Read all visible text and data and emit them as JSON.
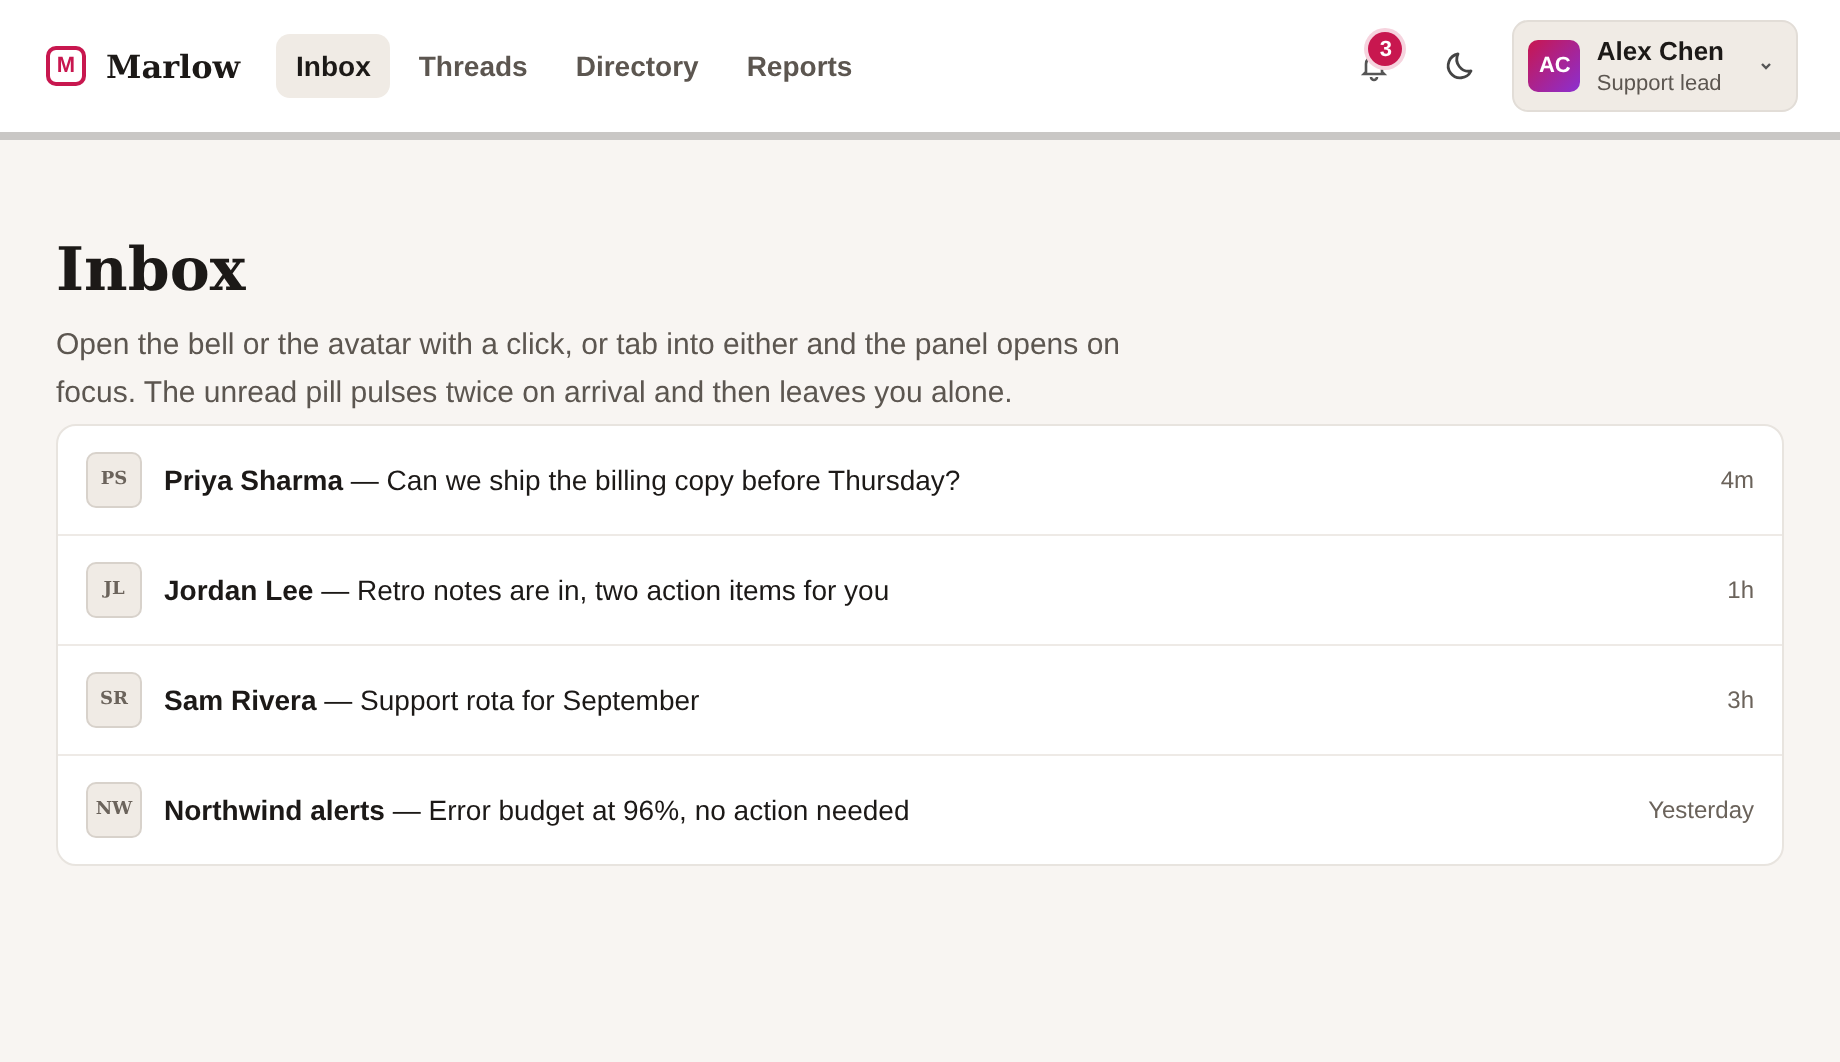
{
  "brand": {
    "name": "Marlow",
    "logo_letter": "M"
  },
  "nav": [
    {
      "label": "Inbox",
      "selected": true
    },
    {
      "label": "Threads",
      "selected": false
    },
    {
      "label": "Directory",
      "selected": false
    },
    {
      "label": "Reports",
      "selected": false
    }
  ],
  "notifications": {
    "count": "3"
  },
  "user": {
    "initials": "AC",
    "name": "Alex Chen",
    "role": "Support lead"
  },
  "page": {
    "title": "Inbox",
    "description": "Open the bell or the avatar with a click, or tab into either and the panel opens on focus. The unread pill pulses twice on arrival and then leaves you alone."
  },
  "messages": [
    {
      "initials": "PS",
      "text": "**Priya Sharma** — Can we ship the billing copy before Thursday?",
      "time": "4m"
    },
    {
      "initials": "JL",
      "text": "**Jordan Lee** — Retro notes are in, two action items for you",
      "time": "1h"
    },
    {
      "initials": "SR",
      "text": "**Sam Rivera** — Support rota for September",
      "time": "3h"
    },
    {
      "initials": "NW",
      "text": "**Northwind alerts** — Error budget at 96%, no action needed",
      "time": "Yesterday"
    }
  ]
}
